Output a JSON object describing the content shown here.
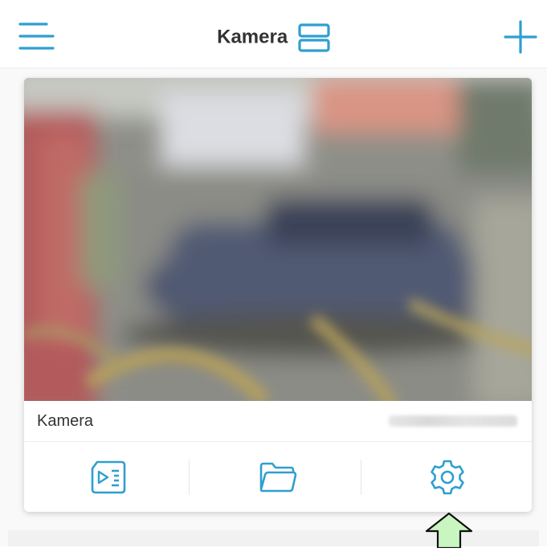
{
  "header": {
    "title": "Kamera",
    "icons": {
      "menu": "hamburger-menu-icon",
      "layout": "layout-toggle-icon",
      "add": "plus-icon"
    }
  },
  "camera_card": {
    "name": "Kamera",
    "actions": [
      {
        "id": "playback",
        "icon": "sd-card-playback-icon"
      },
      {
        "id": "files",
        "icon": "folder-icon"
      },
      {
        "id": "settings",
        "icon": "gear-icon"
      }
    ]
  },
  "colors": {
    "accent": "#2e9fd0",
    "text": "#333333",
    "arrow_fill": "#c8f5c0"
  }
}
